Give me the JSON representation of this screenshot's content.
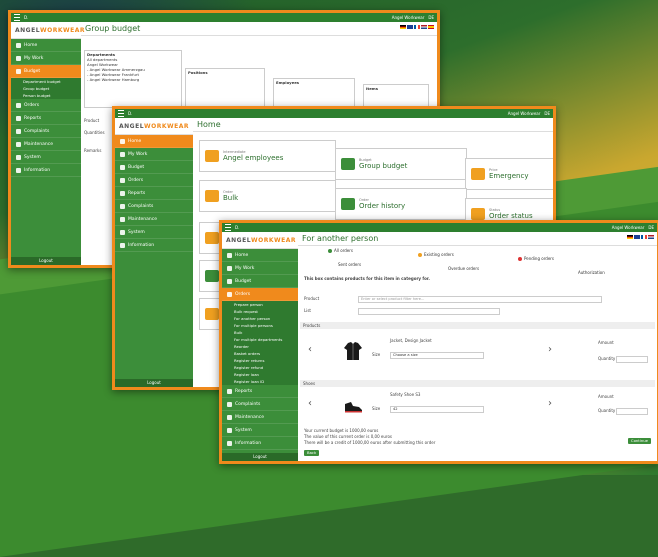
{
  "brand": {
    "logo_text_pre": "ANGEL",
    "logo_text_post": "WORKWEAR"
  },
  "colors": {
    "accent": "#f08a1c",
    "sidebar": "#3c8e3a",
    "topbar": "#2d7f2f"
  },
  "topbar": {
    "menu_label": "",
    "user_label": "Angel Workwear",
    "lang_label": "DE",
    "extra": "D."
  },
  "screen1": {
    "title": "Group budget",
    "nav": [
      {
        "label": "Home"
      },
      {
        "label": "My Work"
      },
      {
        "label": "Budget"
      },
      {
        "label": "Orders"
      },
      {
        "label": "Reports"
      },
      {
        "label": "Complaints"
      },
      {
        "label": "Maintenance"
      },
      {
        "label": "System"
      },
      {
        "label": "Information"
      }
    ],
    "sub": [
      "Department budget",
      "Group budget",
      "Person budget"
    ],
    "group_label": "Departments",
    "group_items": [
      "All departments",
      "Angel Workwear",
      "- Angel Workwear Ammerzgau",
      "- Angel Workwear Frankfurt",
      "- Angel Workwear Hamburg"
    ],
    "list2_label": "Positions",
    "list3_label": "Employees",
    "list4_label": "Items",
    "product_label": "Product",
    "quantities_label": "Quantities",
    "remarks_label": "Remarks",
    "logout": "Logout"
  },
  "screen2": {
    "title": "Home",
    "tiles": [
      {
        "small": "Intermediate",
        "label": "Angel employees"
      },
      {
        "small": "Budget",
        "label": "Group budget"
      },
      {
        "small": "Price",
        "label": "Emergency"
      },
      {
        "small": "Order",
        "label": "Bulk"
      },
      {
        "small": "Order",
        "label": "Order history"
      },
      {
        "small": "Status",
        "label": "Order status"
      }
    ],
    "logout": "Logout"
  },
  "screen3": {
    "title": "For another person",
    "nav": [
      {
        "label": "Home"
      },
      {
        "label": "My Work"
      },
      {
        "label": "Budget"
      },
      {
        "label": "Orders"
      }
    ],
    "sub": [
      "Prepare person",
      "Bulk request",
      "For another person",
      "For multiple persons",
      "Bulk",
      "For multiple departments",
      "Reorder",
      "Basket orders",
      "Register returns",
      "Register refund",
      "Register loan",
      "Register loan ID",
      "Basket orders"
    ],
    "nav_bottom": [
      {
        "label": "Reports"
      },
      {
        "label": "Complaints"
      },
      {
        "label": "Maintenance"
      },
      {
        "label": "System"
      },
      {
        "label": "Information"
      }
    ],
    "statuses": [
      "All orders",
      "Existing orders",
      "Pending orders",
      "Overdue orders",
      "Authorization",
      "Sent orders"
    ],
    "notice": "This box contains products for this item in category for.",
    "product_label": "Product",
    "filter_placeholder": "Enter or select product filter here...",
    "list_label": "List",
    "section_products": "Products",
    "section_shoes": "Shoes",
    "jacket_name": "Jacket, Design Jacket",
    "size_label": "Size",
    "size_value": "Choose a size",
    "shoe_name": "Safety Shoe S3",
    "shoe_size": "42",
    "amount_label": "Amount",
    "quantity_label": "Quantity",
    "budget_line1": "Your current budget is 1000,00 euros",
    "budget_line2": "The value of this current order is 0,00 euros",
    "budget_line3": "There will be a credit of 1000,00 euros after submitting this order",
    "next_button": "Continue",
    "back_button": "Back",
    "logout": "Logout"
  }
}
